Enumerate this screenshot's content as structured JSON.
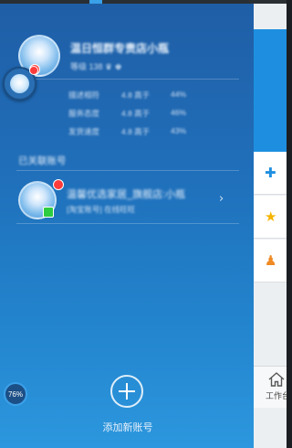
{
  "account": {
    "name": "温日恒群专责店小瓶",
    "level_line": "等级 138 ♛ ♚",
    "stats": [
      {
        "label": "描述相符",
        "value": "4.8 高于",
        "pct": "44%"
      },
      {
        "label": "服务态度",
        "value": "4.8 高于",
        "pct": "46%"
      },
      {
        "label": "发货速度",
        "value": "4.8 高于",
        "pct": "43%"
      }
    ]
  },
  "other_accounts": {
    "title": "已关联账号",
    "items": [
      {
        "name": "温馨优选家居_旗舰店:小瓶",
        "subtitle": "[淘宝账号] 在线旺旺"
      }
    ]
  },
  "add_account": {
    "label": "添加新账号"
  },
  "floating_widget": {
    "percent": "76%"
  },
  "right_panel": {
    "tab_label": "工作台",
    "icons": [
      "puzzle-icon",
      "star-icon",
      "person-icon",
      "home-icon"
    ]
  },
  "colors": {
    "panel_top": "#1f5ea6",
    "panel_bottom": "#2c97de",
    "accent_blue": "#1e8fe0",
    "badge_red": "#ff3b3b",
    "badge_green": "#2ecc40",
    "star": "#f5b400",
    "person": "#f08a24"
  }
}
